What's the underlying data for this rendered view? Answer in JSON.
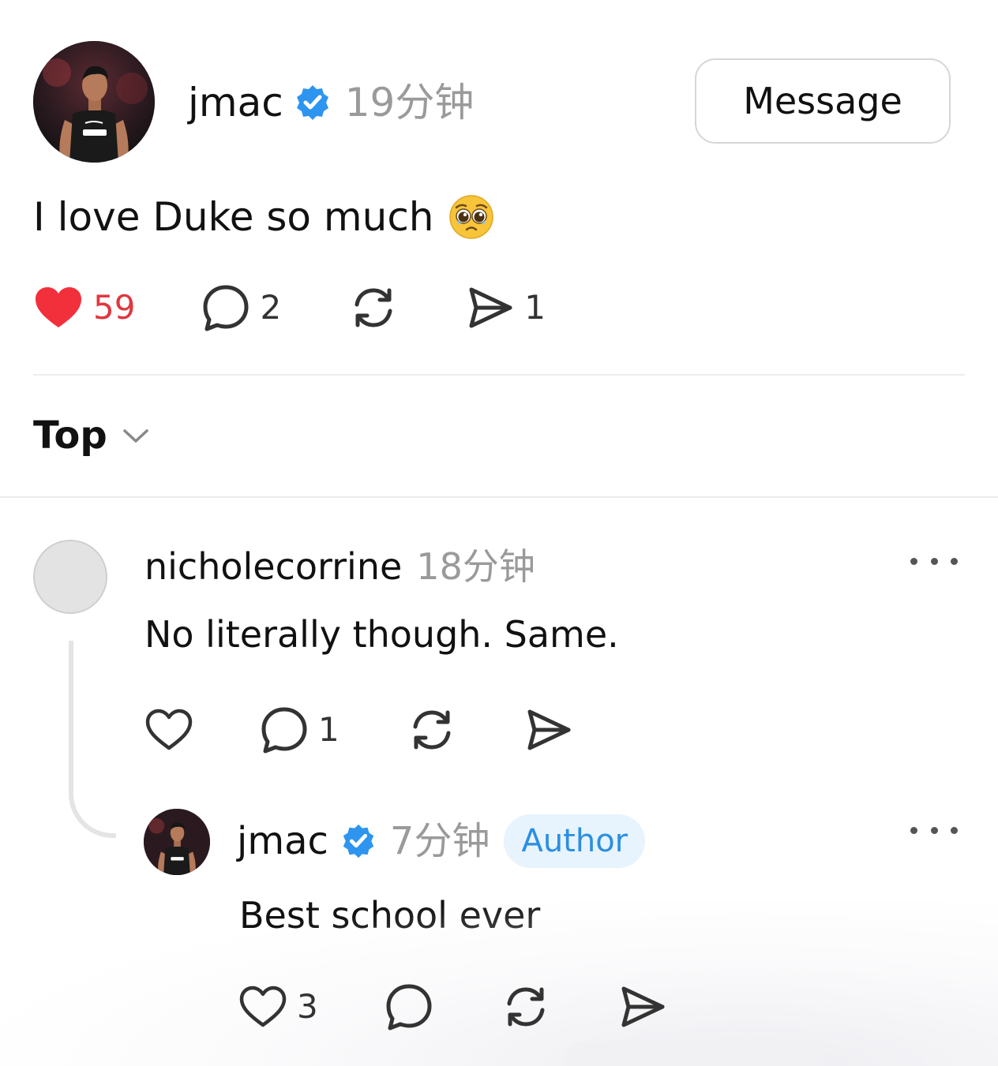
{
  "post": {
    "author": "jmac",
    "time": "19分钟",
    "message_button": "Message",
    "text": "I love Duke so much",
    "emoji": "pleading-face-emoji",
    "likes": "59",
    "comments": "2",
    "shares": "1"
  },
  "sort": {
    "label": "Top"
  },
  "comment": {
    "username": "nicholecorrine",
    "time": "18分钟",
    "text": "No literally though. Same.",
    "replies": "1"
  },
  "reply": {
    "username": "jmac",
    "time": "7分钟",
    "badge": "Author",
    "text": "Best school ever",
    "likes": "3"
  },
  "colors": {
    "like_red": "#e0373f",
    "verified_blue": "#2d95ef",
    "author_badge_bg": "#e7f3fd",
    "author_badge_text": "#2b8fe0",
    "muted_text": "#9a9a9a"
  }
}
